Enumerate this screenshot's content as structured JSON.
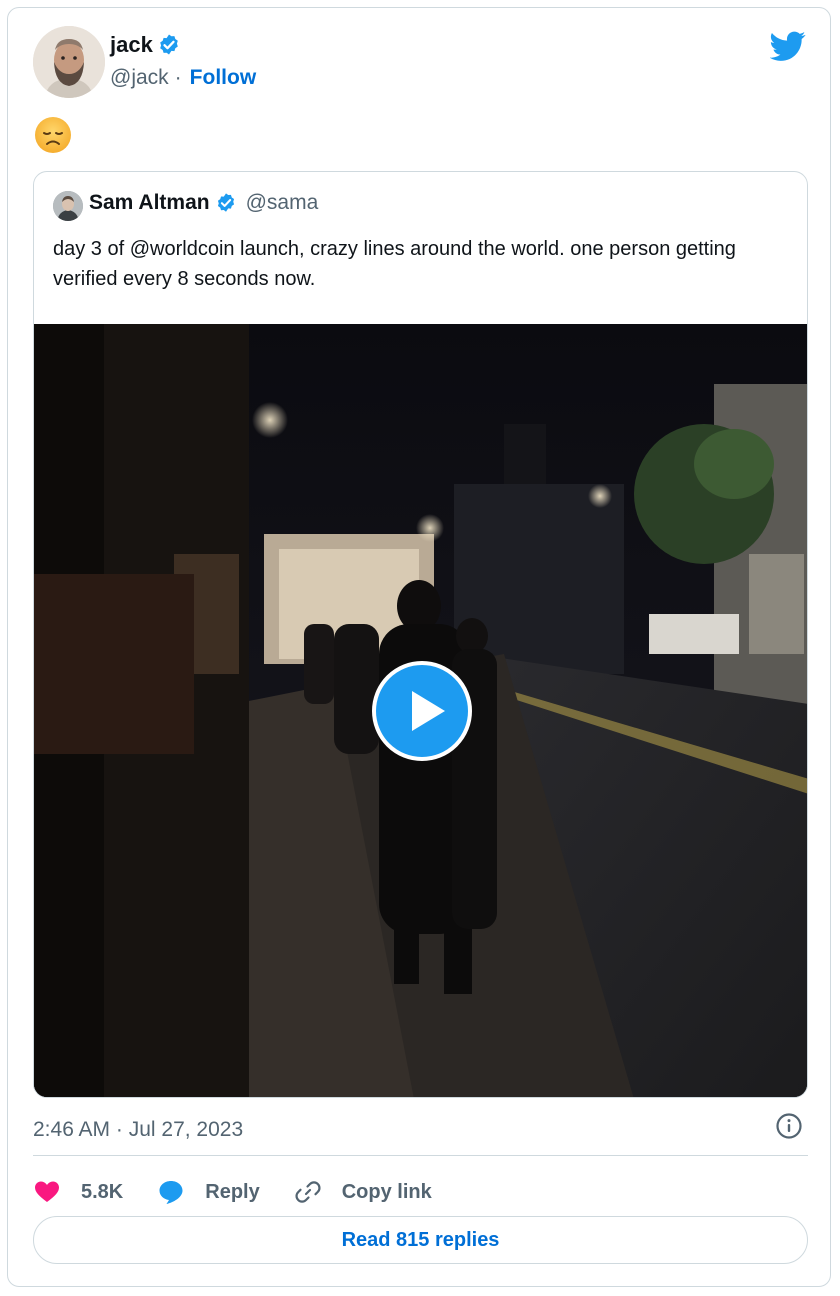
{
  "author": {
    "name": "jack",
    "handle": "@jack",
    "separator": "·",
    "follow_label": "Follow"
  },
  "tweet": {
    "text_emoji": "disappointed-face"
  },
  "quoted": {
    "name": "Sam Altman",
    "handle": "@sama",
    "text": "day 3 of @worldcoin launch, crazy lines around the world. one person getting verified every 8 seconds now."
  },
  "meta": {
    "timestamp": "2:46 AM · Jul 27, 2023"
  },
  "actions": {
    "likes": "5.8K",
    "reply": "Reply",
    "copy_link": "Copy link"
  },
  "footer": {
    "read_replies": "Read 815 replies"
  },
  "colors": {
    "brand": "#1d9bf0",
    "link": "#006fd6",
    "like": "#f91880",
    "text_secondary": "#536471",
    "border": "#cfd9de"
  }
}
